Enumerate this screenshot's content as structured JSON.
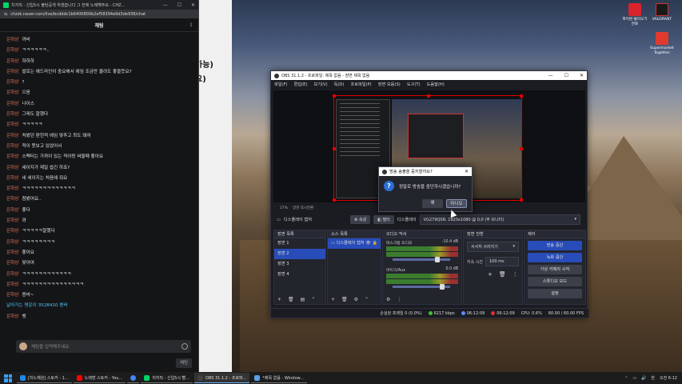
{
  "chat_window": {
    "title": "치지직 - 신입5시 불탄공개 하겠습니다 그 전에 노래해주요 - CHZ...",
    "url": "chzzk.naver.com/live/bcdddc1b6400800b2ef58394e9d3de938/chat",
    "header": "채팅",
    "messages": [
      {
        "nick": "은하상",
        "text": "까비"
      },
      {
        "nick": "은하상",
        "text": "ㅋㅋㅋㅋㅋㅋ.."
      },
      {
        "nick": "은하상",
        "text": "하하하"
      },
      {
        "nick": "은하상",
        "text": "발로는 헤드라인이 중요해서 에임 조금만 올려도 좋을듯요?"
      },
      {
        "nick": "은하상",
        "text": "?"
      },
      {
        "nick": "은하상",
        "text": "으음"
      },
      {
        "nick": "은하상",
        "text": "나이스"
      },
      {
        "nick": "은하상",
        "text": "그래도 잘했다"
      },
      {
        "nick": "은하상",
        "text": "ㅋㅋㅋㅋㅋ"
      },
      {
        "nick": "은하상",
        "text": "처봤던 편헌적 에임 맞추고 최도 돼여"
      },
      {
        "nick": "은하상",
        "text": "적이 못보고 있었어서"
      },
      {
        "nick": "은하상",
        "text": "스펙터는 가까이 있는 적이랑 싸울때 좋아요"
      },
      {
        "nick": "은하상",
        "text": "세이지가 제일 쉽긴 하죠?"
      },
      {
        "nick": "은하상",
        "text": "네 세이지는 처음에 줘요"
      },
      {
        "nick": "은하상",
        "text": "ㅋㅋㅋㅋㅋㅋㅋㅋㅋㅋㅋㅋㅋ"
      },
      {
        "nick": "은하상",
        "text": "참봤어요.."
      },
      {
        "nick": "은하상",
        "text": "좋다"
      },
      {
        "nick": "은하상",
        "text": "와"
      },
      {
        "nick": "은하상",
        "text": "ㅋㅋㅋㅋㅋ잘했다"
      },
      {
        "nick": "은하상",
        "text": "ㅋㅋㅋㅋㅋㅋㅋㅋ"
      },
      {
        "nick": "은하상",
        "text": "좋아요"
      },
      {
        "nick": "은하상",
        "text": "맞아여"
      },
      {
        "nick": "은하상",
        "text": "ㅋㅋㅋㅋㅋㅋㅋㅋㅋㅋㅋㅋ"
      },
      {
        "nick": "은하상",
        "text": "ㅋㅋㅋㅋㅋㅋㅋㅋㅋㅋㅋㅋㅋㅋㅋ"
      },
      {
        "nick": "은하상",
        "text": "용바~"
      },
      {
        "nick": "",
        "text": "날아가는 명운이 3528410 용바",
        "system": true
      },
      {
        "nick": "은하상",
        "text": "뱅"
      }
    ],
    "input_placeholder": "채팅을 입력해주세요",
    "send_label": "채팅"
  },
  "background_window": {
    "fragments": [
      "가능)",
      "요)"
    ]
  },
  "obs": {
    "title": "OBS 31.1.2 - 프로파일: 제목 없음 - 장면 제목 없음",
    "menu": [
      "파일(F)",
      "편집(E)",
      "보기(V)",
      "독(D)",
      "프로파일(P)",
      "장면 모음(S)",
      "도구(T)",
      "도움말(H)"
    ],
    "preview_bar": [
      "27%",
      "장면 즉시전환"
    ],
    "source_name": "디스플레이 캡처",
    "props_label": "속성",
    "filter_label": "필터",
    "display_label": "디스플레이",
    "display_value": "VG279QSR: 1920x1080 @ 0,0 (주 모니터)",
    "scenes": {
      "header": "장면 목록",
      "items": [
        "장면 1",
        "장면 2",
        "장면 3",
        "장면 4"
      ],
      "selected": 1
    },
    "sources": {
      "header": "소스 목록",
      "items": [
        "디스플레이 캡처"
      ]
    },
    "mixer": {
      "header": "오디오 믹서",
      "channels": [
        {
          "name": "데스크탑 오디오",
          "db": "-10.4 dB",
          "level": 0.78
        },
        {
          "name": "마이크/Aux",
          "db": "0.0 dB",
          "level": 0.86
        }
      ]
    },
    "transitions": {
      "header": "장면 전환",
      "type": "서서히 사라지기",
      "duration_label": "지속 시간",
      "duration": "100 ms"
    },
    "controls": {
      "header": "제어",
      "buttons": [
        "방송 중단",
        "녹화 중단",
        "가상 카메라 시작",
        "스튜디오 모드",
        "설정"
      ]
    },
    "status": {
      "dropped": "손실된 프레임 0 (0.0%)",
      "bitrate": "6217 kbps",
      "stream_time": "06:12:09",
      "rec_time": "06:12:09",
      "cpu": "CPU: 0.6%",
      "fps": "60.00 / 60.00 FPS"
    }
  },
  "dialog": {
    "title": "방송 송출을 중지할까요?",
    "question": "정말로 방송을 중단하시겠습니까?",
    "yes": "예",
    "no": "아니오"
  },
  "desktop_icons": [
    {
      "label": "파이썬 불러오기 연료",
      "color": "#d9232d"
    },
    {
      "label": "VALORANT",
      "color": "#1a1a1a"
    },
    {
      "label": "Supermarket Together",
      "color": "#e03a2f"
    }
  ],
  "taskbar": {
    "items": [
      {
        "label": "[치노채원] 스토커 - 1...",
        "color": "#1e88e5"
      },
      {
        "label": "노래방 스토커 - You...",
        "color": "#ff0000"
      },
      {
        "label": "",
        "color": "#4285f4"
      },
      {
        "label": "치지직 - 신입5시 빨...",
        "color": "#00d564"
      },
      {
        "label": "OBS 31.1.2 - 프로파...",
        "color": "#2a2a2a",
        "active": true
      },
      {
        "label": "*제목 없음 - Window...",
        "color": "#5aa0e6"
      }
    ],
    "time": "오전 6:12",
    "lang": "한"
  }
}
